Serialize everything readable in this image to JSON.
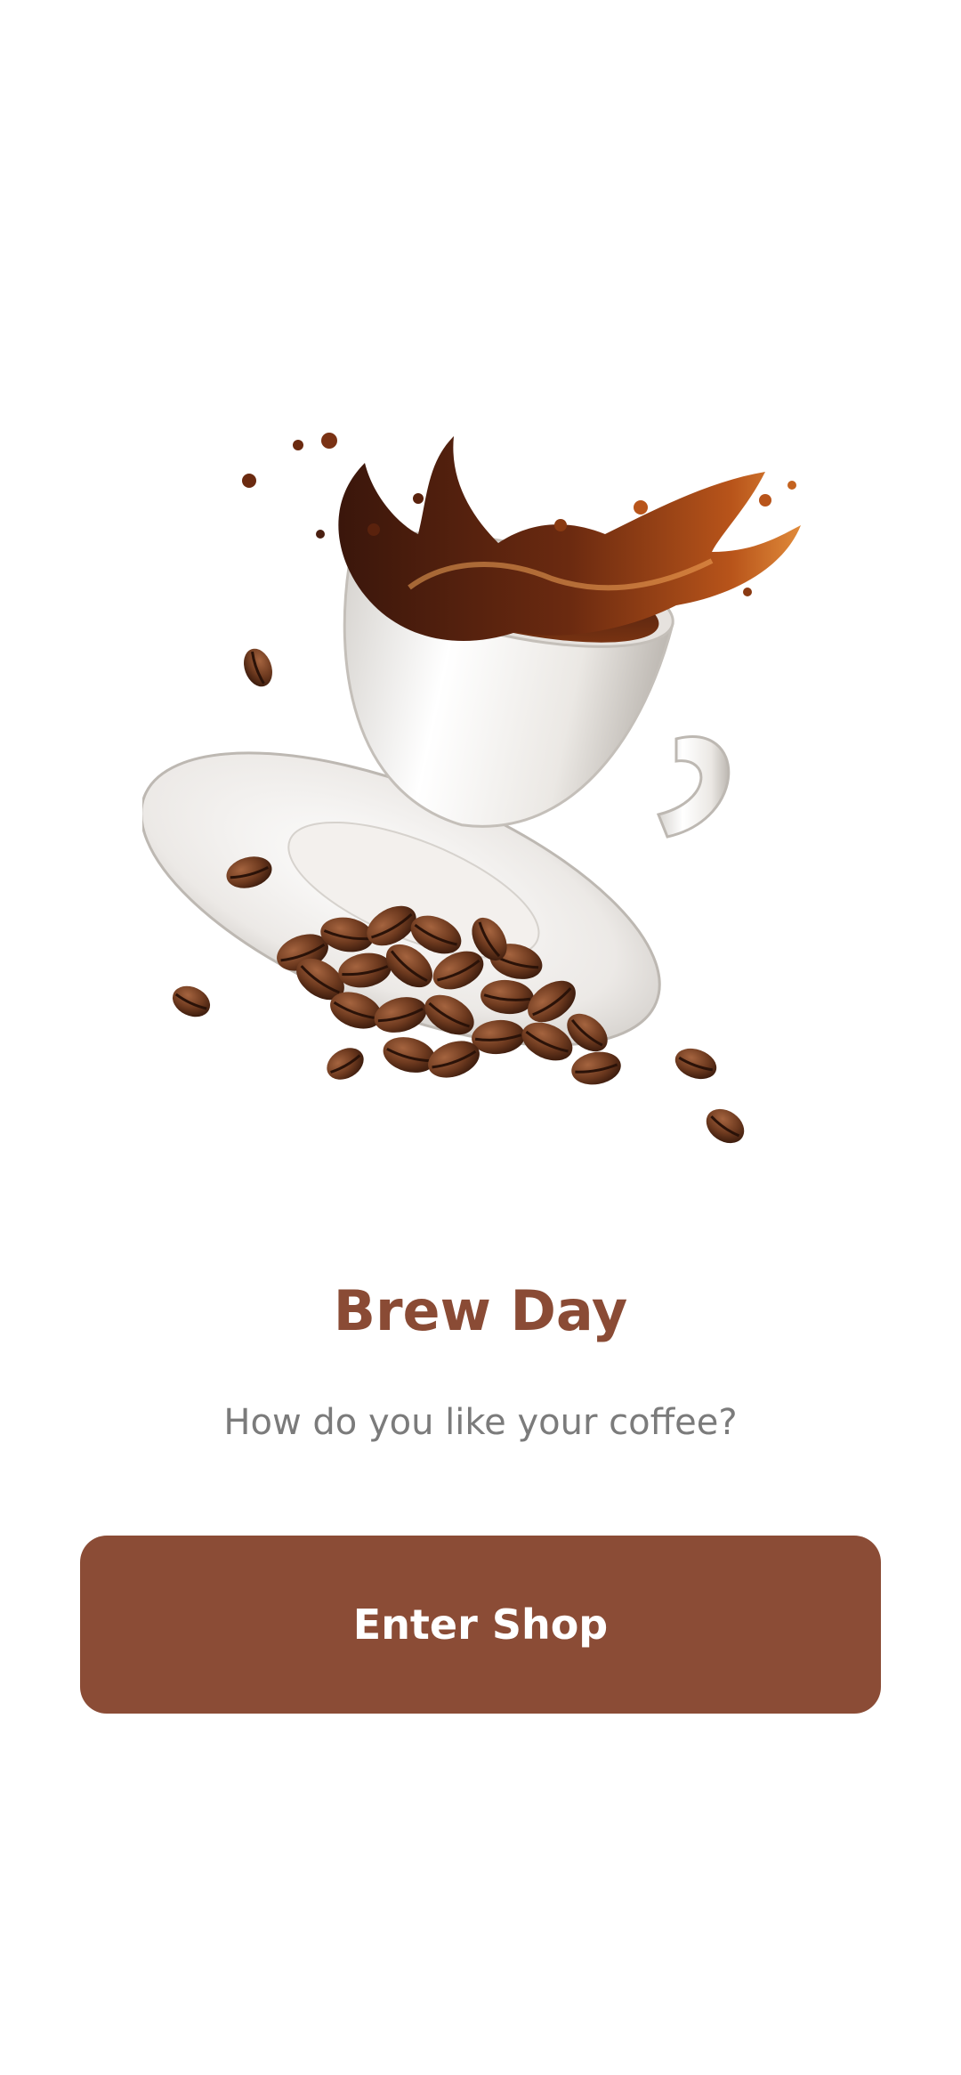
{
  "screen": {
    "title": "Brew Day",
    "subtitle": "How do you like your coffee?",
    "enter_button_label": "Enter Shop"
  },
  "hero": {
    "icon": "coffee-cup-splash-illustration"
  },
  "colors": {
    "background": "#ffffff",
    "brand_brown": "#8b4c36",
    "title_color": "#8a4b35",
    "subtitle_color": "#7b7b7b",
    "button_text": "#ffffff"
  }
}
